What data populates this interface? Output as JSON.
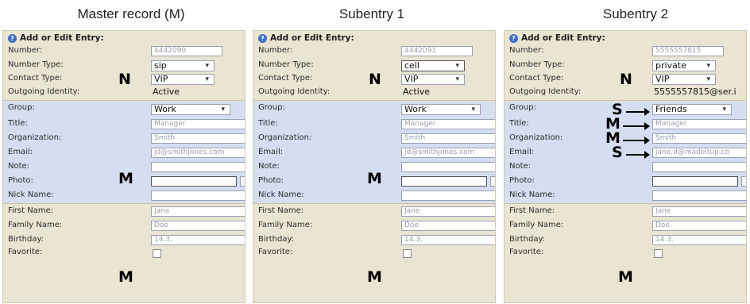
{
  "headers": [
    "Master record (M)",
    "Subentry 1",
    "Subentry 2"
  ],
  "panel_title": "Add or Edit Entry:",
  "labels": {
    "number": "Number:",
    "number_type": "Number Type:",
    "contact_type": "Contact Type:",
    "outgoing_identity": "Outgoing Identity:",
    "group": "Group:",
    "title": "Title:",
    "organization": "Organization:",
    "email": "Email:",
    "note": "Note:",
    "photo": "Photo:",
    "nick_name": "Nick Name:",
    "first_name": "First Name:",
    "family_name": "Family Name:",
    "birthday": "Birthday:",
    "favorite": "Favorite:"
  },
  "panels": [
    {
      "number": "4442090",
      "number_type": "sip",
      "contact_type": "VIP",
      "outgoing_identity": "Active",
      "group": "Work",
      "title": "Manager",
      "organization": "Smith",
      "email": "jd@smithjones.com",
      "first_name": "Jane",
      "family_name": "Doe",
      "birthday": "14.3."
    },
    {
      "number": "4442091",
      "number_type": "cell",
      "contact_type": "VIP",
      "outgoing_identity": "Active",
      "group": "Work",
      "title": "Manager",
      "organization": "Smith",
      "email": "jd@smithjones.com",
      "first_name": "Jane",
      "family_name": "Doe",
      "birthday": "14.3."
    },
    {
      "number": "5555557815",
      "number_type": "private",
      "contact_type": "VIP",
      "outgoing_identity": "5555557815@ser.i",
      "group": "Friends",
      "title": "Manager",
      "organization": "Smith",
      "email": "jane.d@madeitup.co",
      "first_name": "Jane",
      "family_name": "Doe",
      "birthday": "14.3."
    }
  ],
  "markers": {
    "n": "N",
    "m": "M",
    "s": "S"
  }
}
